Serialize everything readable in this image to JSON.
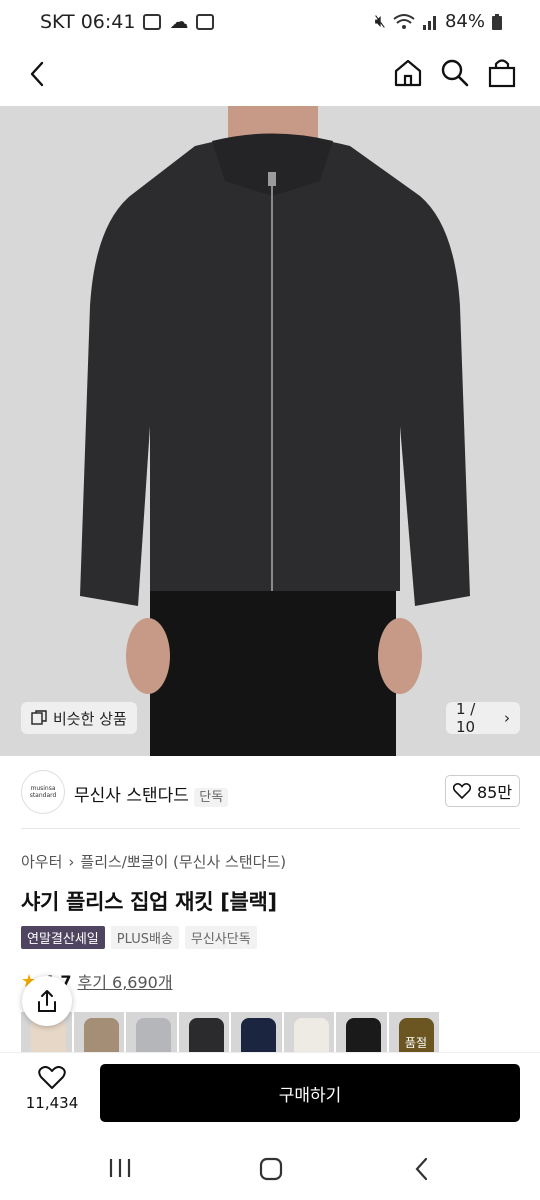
{
  "status_bar": {
    "carrier_time": "SKT 06:41",
    "battery": "84%",
    "left_icons": [
      "copy-icon",
      "cloud-icon",
      "image-icon"
    ],
    "right_icons": [
      "mute-icon",
      "wifi-icon",
      "signal-icon",
      "battery-icon"
    ]
  },
  "header": {
    "icons": [
      "back-icon",
      "home-icon",
      "search-icon",
      "bag-icon"
    ]
  },
  "hero": {
    "similar_label": "비슷한 상품",
    "pager": "1 / 10"
  },
  "brand": {
    "logo_text_line1": "musinsa",
    "logo_text_line2": "standard",
    "name": "무신사 스탠다드",
    "badge": "단독",
    "likes": "85만"
  },
  "product": {
    "breadcrumb_1": "아우터",
    "breadcrumb_2": "플리스/뽀글이 (무신사 스탠다드)",
    "title": "샤기 플리스 집업 재킷 [블랙]",
    "tags": [
      "연말결산세일",
      "PLUS배송",
      "무신사단독"
    ],
    "rating": "4.7",
    "reviews": "후기 6,690개",
    "swatch_colors": [
      "#e7d7c6",
      "#a48e76",
      "#b4b6ba",
      "#2b2b2d",
      "#1c2540",
      "#eeebe4",
      "#1a1a1a",
      "#6b5622"
    ],
    "swatch_soldout_label": "품절"
  },
  "bottom": {
    "wish_count": "11,434",
    "buy_label": "구매하기"
  },
  "colors": {
    "sale_tag": "#4f4560",
    "buy_button": "#000000",
    "star": "#f2a900"
  }
}
